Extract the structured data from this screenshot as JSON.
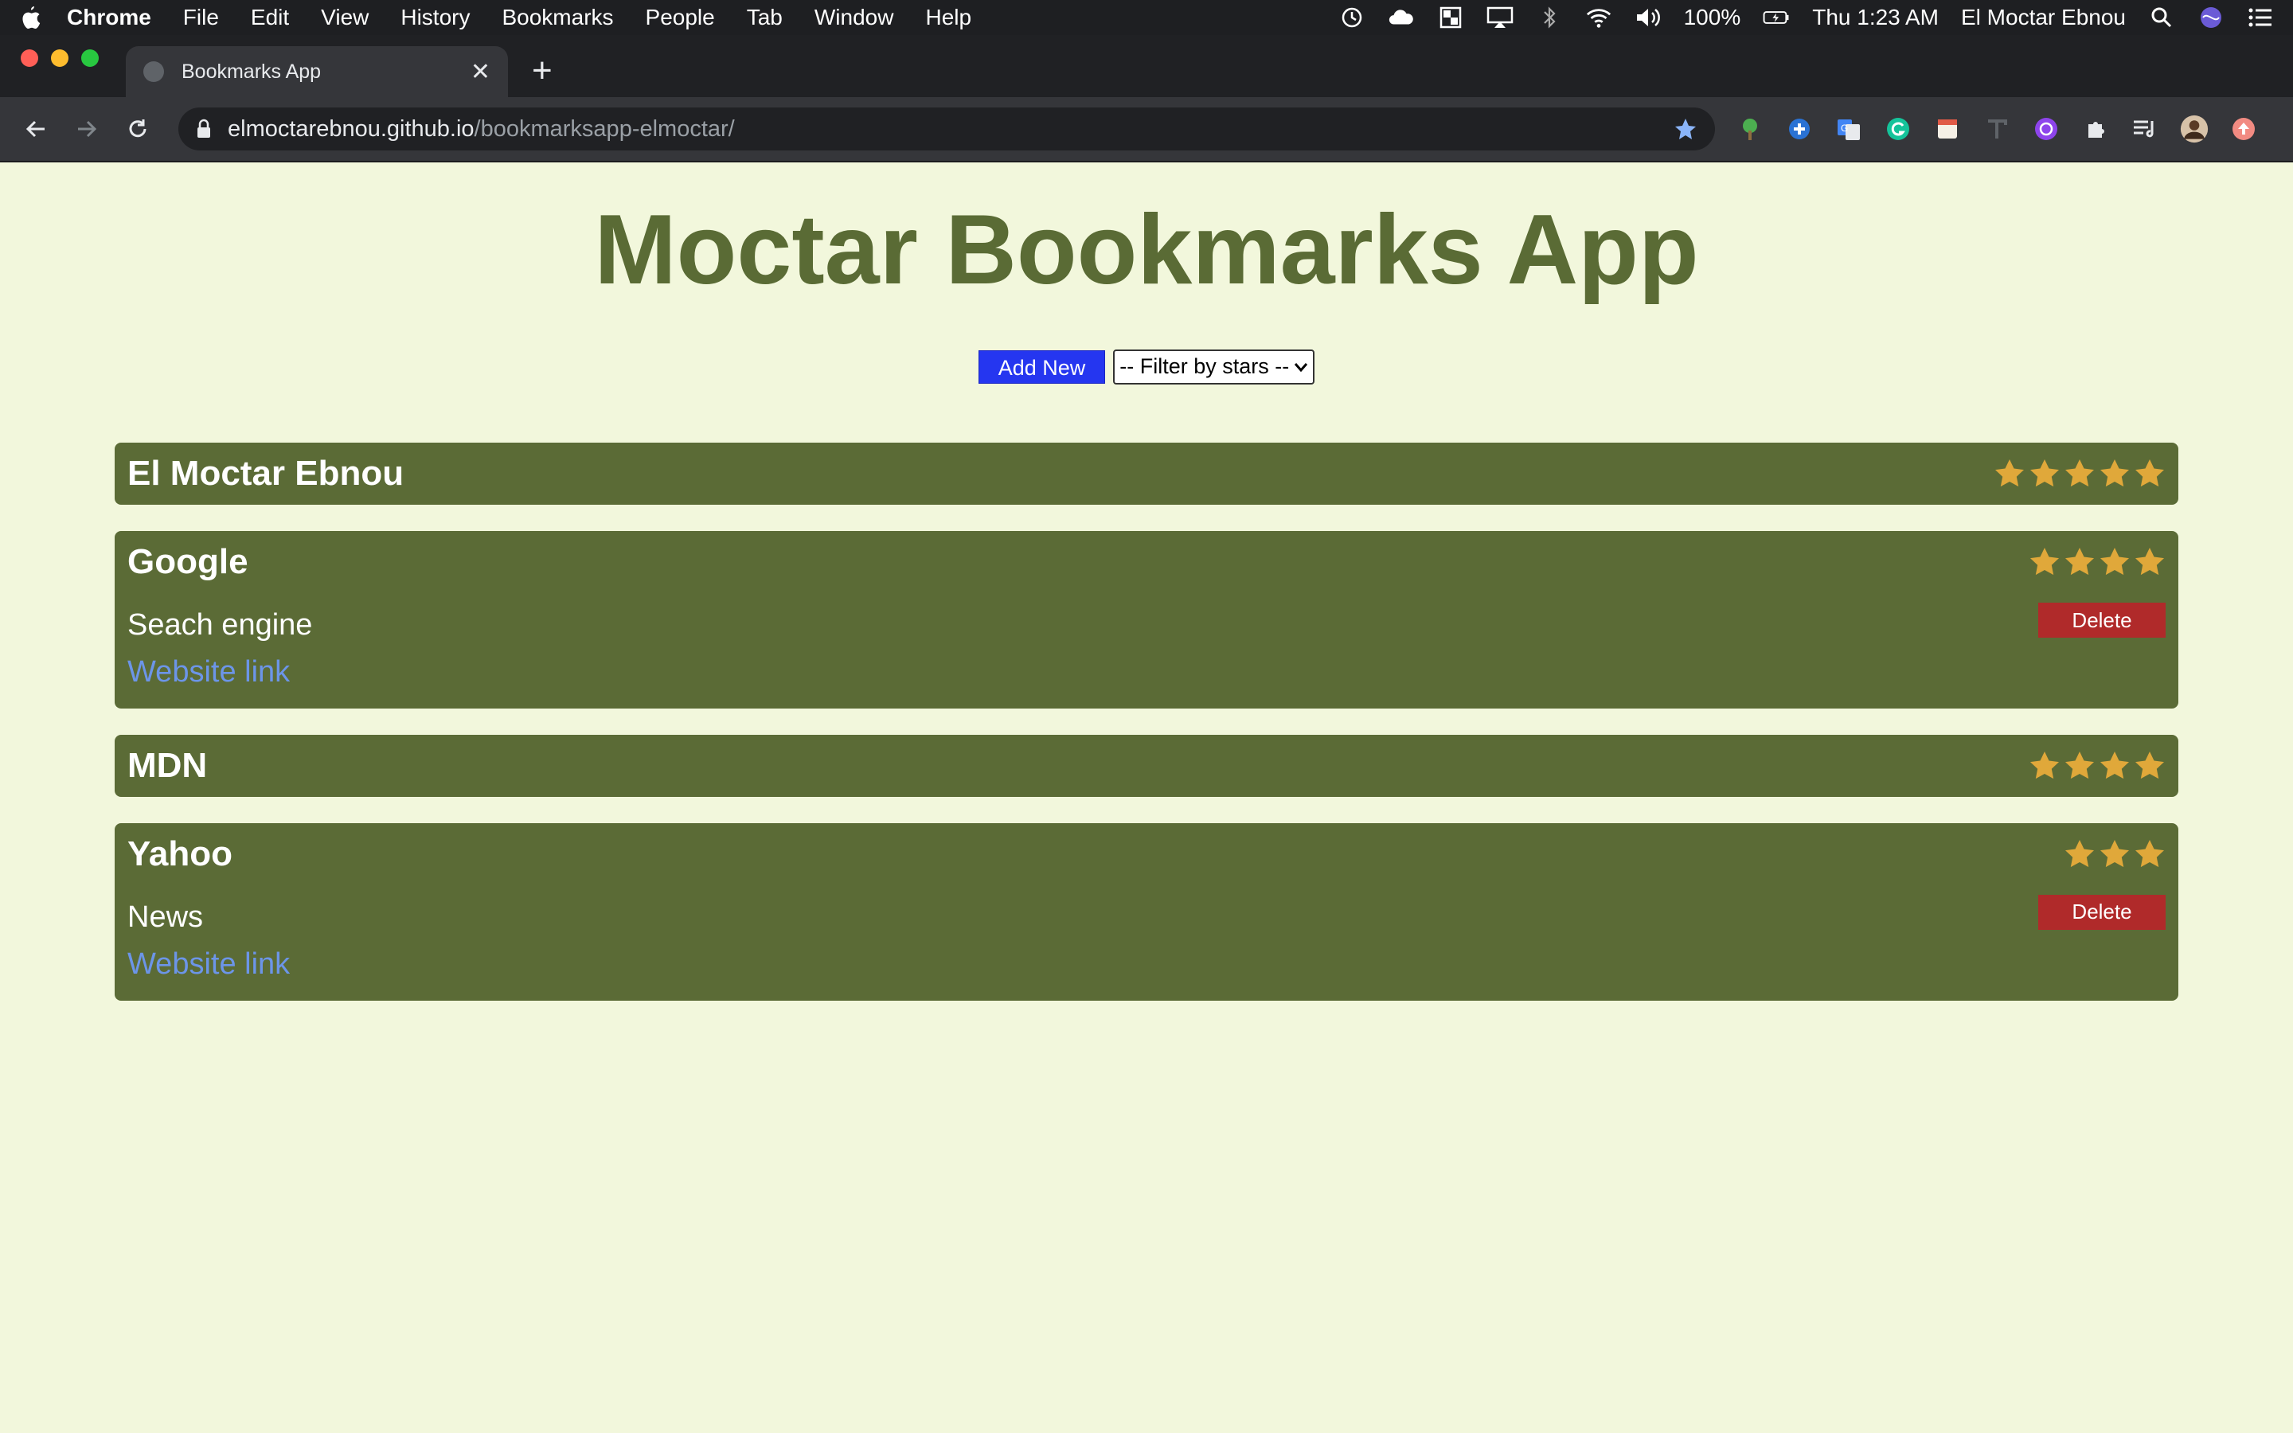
{
  "menubar": {
    "app_name": "Chrome",
    "items": [
      "File",
      "Edit",
      "View",
      "History",
      "Bookmarks",
      "People",
      "Tab",
      "Window",
      "Help"
    ],
    "battery": "100%",
    "clock": "Thu 1:23 AM",
    "user": "El Moctar Ebnou"
  },
  "browser": {
    "tab_title": "Bookmarks App",
    "url_host": "elmoctarebnou.github.io",
    "url_path": "/bookmarksapp-elmoctar/"
  },
  "app": {
    "title": "Moctar Bookmarks App",
    "add_label": "Add New",
    "filter_label": "-- Filter by stars --",
    "delete_label": "Delete",
    "link_label": "Website link"
  },
  "bookmarks": [
    {
      "name": "El Moctar Ebnou",
      "rating": 5,
      "expanded": false
    },
    {
      "name": "Google",
      "rating": 4,
      "expanded": true,
      "description": "Seach engine"
    },
    {
      "name": "MDN",
      "rating": 4,
      "expanded": false
    },
    {
      "name": "Yahoo",
      "rating": 3,
      "expanded": true,
      "description": "News"
    }
  ],
  "colors": {
    "page_bg": "#f2f7dc",
    "title": "#5a6b35",
    "card": "#5b6b36",
    "star": "#e0a83a",
    "delete": "#b02a2a",
    "add": "#2536f0",
    "link": "#6c95e8"
  }
}
